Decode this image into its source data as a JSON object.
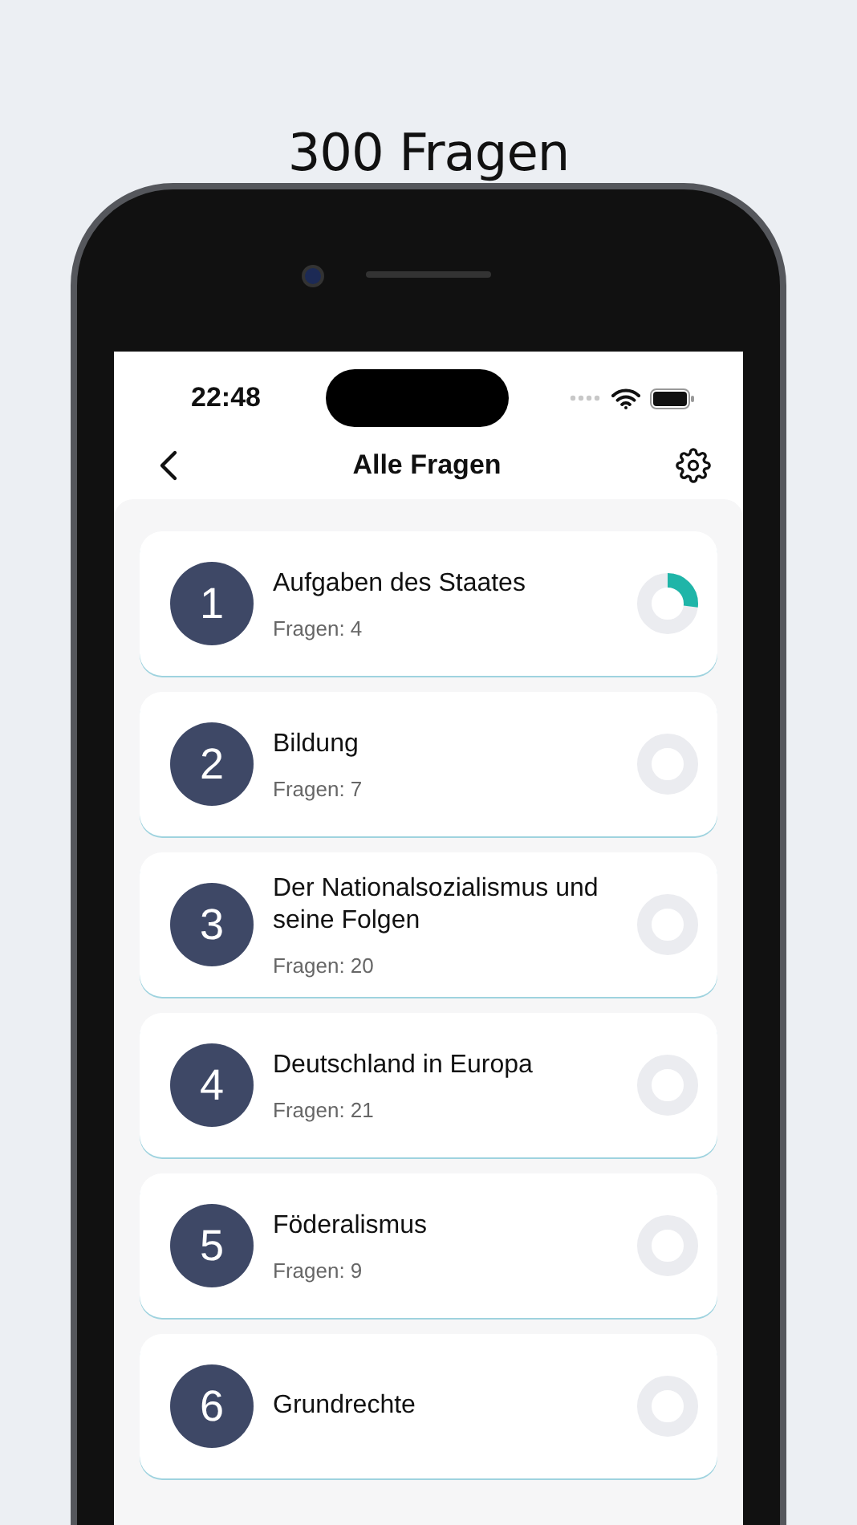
{
  "headline": "300 Fragen",
  "status_bar": {
    "time": "22:48"
  },
  "nav": {
    "title": "Alle Fragen"
  },
  "topics": [
    {
      "number": "1",
      "title": "Aufgaben des Staates",
      "count": "Fragen: 4",
      "level": 0.27
    },
    {
      "number": "2",
      "title": "Bildung",
      "count": "Fragen: 7"
    },
    {
      "number": "3",
      "title": "Der Nationalsozialismus und seine Folgen",
      "count": "Fragen: 20"
    },
    {
      "number": "4",
      "title": "Deutschland in Europa",
      "count": "Fragen: 21"
    },
    {
      "number": "5",
      "title": "Föderalismus",
      "count": "Fragen: 9"
    },
    {
      "number": "6",
      "title": "Grundrechte"
    }
  ]
}
